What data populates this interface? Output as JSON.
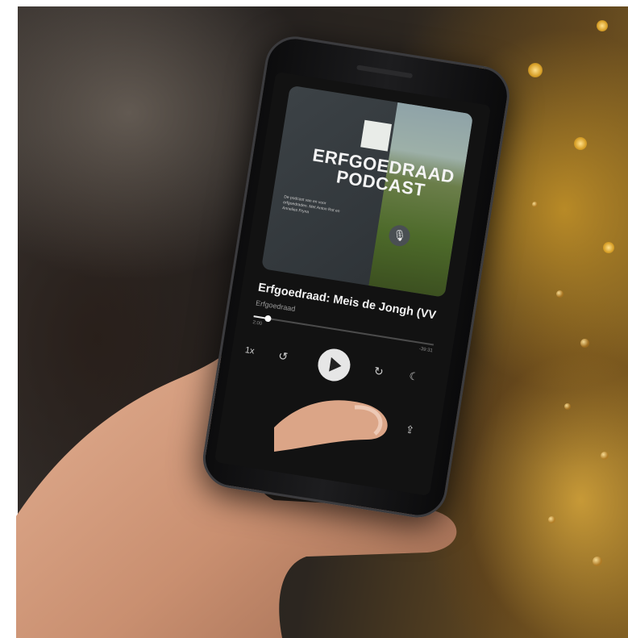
{
  "podcast": {
    "cover_title_line1": "ERFGOEDRAAD",
    "cover_title_line2": "PODCAST",
    "cover_small_text": "De podcast van en voor erfgoedraden. Met Anton Rot en Annelies Fryna",
    "episode_title": "Erfgoedraad: Meis de Jongh (VV",
    "show_name": "Erfgoedraad",
    "time_elapsed": "2:00",
    "time_remaining": "-39:31",
    "progress_fraction": 0.08,
    "speed_label": "1x"
  },
  "icons": {
    "mic": "microphone-icon",
    "rewind": "rewind-15-icon",
    "play": "play-icon",
    "forward": "forward-15-icon",
    "sleep": "moon-icon",
    "share": "share-icon"
  },
  "colors": {
    "app_background": "#121212",
    "bokeh": "#e0a830"
  }
}
